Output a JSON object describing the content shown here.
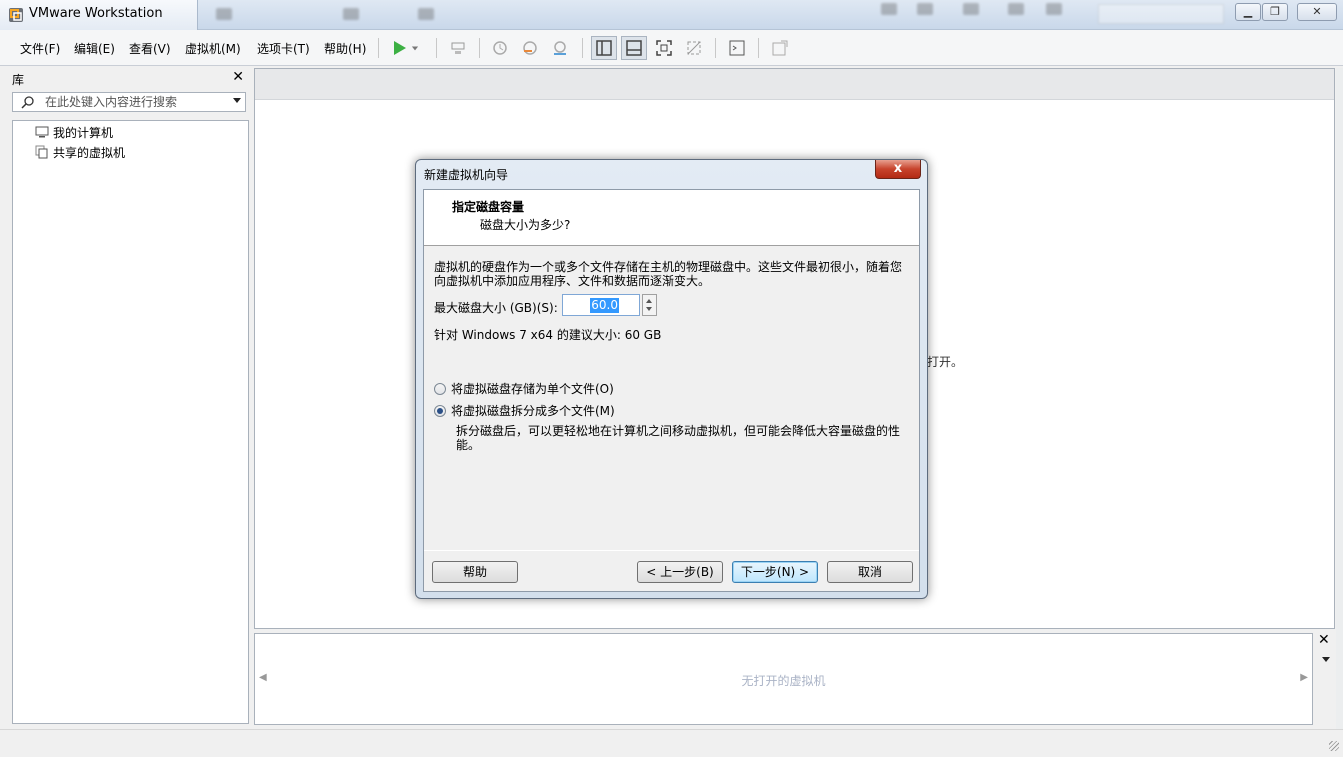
{
  "window": {
    "title": "VMware Workstation"
  },
  "menu": {
    "items": [
      "文件(F)",
      "编辑(E)",
      "查看(V)",
      "虚拟机(M)",
      "选项卡(T)",
      "帮助(H)"
    ]
  },
  "library": {
    "title": "库",
    "search_placeholder": "在此处键入内容进行搜索",
    "tree": [
      "我的计算机",
      "共享的虚拟机"
    ]
  },
  "main": {
    "hint_tail": "打开。"
  },
  "thumbnail_bar": {
    "empty_text": "无打开的虚拟机"
  },
  "dialog": {
    "title": "新建虚拟机向导",
    "close_label": "x",
    "header_title": "指定磁盘容量",
    "header_subtitle": "磁盘大小为多少?",
    "description": "虚拟机的硬盘作为一个或多个文件存储在主机的物理磁盘中。这些文件最初很小，随着您向虚拟机中添加应用程序、文件和数据而逐渐变大。",
    "max_size_label": "最大磁盘大小 (GB)(S):",
    "max_size_value": "60.0",
    "recommended": "针对 Windows 7 x64 的建议大小: 60 GB",
    "options": [
      {
        "label": "将虚拟磁盘存储为单个文件(O)",
        "checked": false
      },
      {
        "label": "将虚拟磁盘拆分成多个文件(M)",
        "checked": true
      }
    ],
    "split_description": "拆分磁盘后，可以更轻松地在计算机之间移动虚拟机，但可能会降低大容量磁盘的性能。",
    "buttons": {
      "help": "帮助",
      "back": "< 上一步(B)",
      "next": "下一步(N) >",
      "cancel": "取消"
    }
  },
  "colors": {
    "accent": "#3399ff",
    "close_red": "#c7432c",
    "play_green": "#3cb043"
  }
}
